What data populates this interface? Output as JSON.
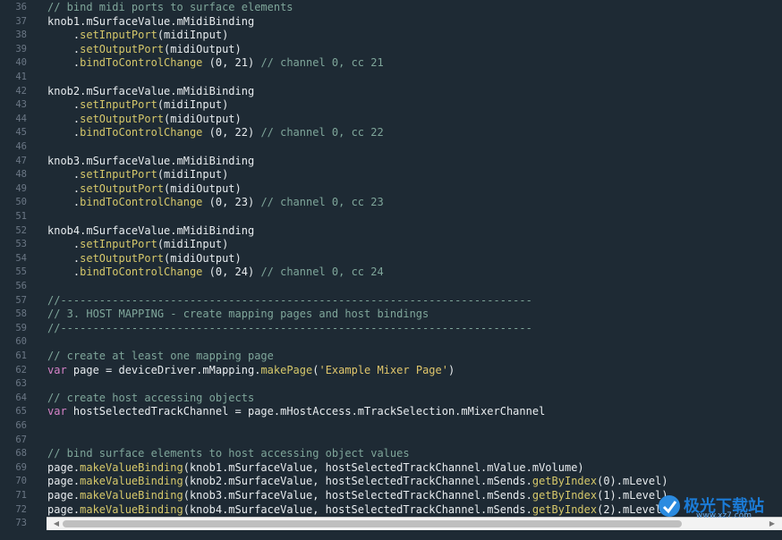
{
  "lines": [
    {
      "num": "36",
      "tokens": [
        {
          "t": "// bind midi ports to surface elements",
          "c": "comment"
        }
      ]
    },
    {
      "num": "37",
      "tokens": [
        {
          "t": "knob1.mSurfaceValue.mMidiBinding",
          "c": "plain"
        }
      ]
    },
    {
      "num": "38",
      "tokens": [
        {
          "t": "    .",
          "c": "plain"
        },
        {
          "t": "setInputPort",
          "c": "method"
        },
        {
          "t": "(midiInput)",
          "c": "plain"
        }
      ]
    },
    {
      "num": "39",
      "tokens": [
        {
          "t": "    .",
          "c": "plain"
        },
        {
          "t": "setOutputPort",
          "c": "method"
        },
        {
          "t": "(midiOutput)",
          "c": "plain"
        }
      ]
    },
    {
      "num": "40",
      "tokens": [
        {
          "t": "    .",
          "c": "plain"
        },
        {
          "t": "bindToControlChange",
          "c": "method"
        },
        {
          "t": " (0, 21) ",
          "c": "plain"
        },
        {
          "t": "// channel 0, cc 21",
          "c": "comment"
        }
      ]
    },
    {
      "num": "41",
      "tokens": []
    },
    {
      "num": "42",
      "tokens": [
        {
          "t": "knob2.mSurfaceValue.mMidiBinding",
          "c": "plain"
        }
      ]
    },
    {
      "num": "43",
      "tokens": [
        {
          "t": "    .",
          "c": "plain"
        },
        {
          "t": "setInputPort",
          "c": "method"
        },
        {
          "t": "(midiInput)",
          "c": "plain"
        }
      ]
    },
    {
      "num": "44",
      "tokens": [
        {
          "t": "    .",
          "c": "plain"
        },
        {
          "t": "setOutputPort",
          "c": "method"
        },
        {
          "t": "(midiOutput)",
          "c": "plain"
        }
      ]
    },
    {
      "num": "45",
      "tokens": [
        {
          "t": "    .",
          "c": "plain"
        },
        {
          "t": "bindToControlChange",
          "c": "method"
        },
        {
          "t": " (0, 22) ",
          "c": "plain"
        },
        {
          "t": "// channel 0, cc 22",
          "c": "comment"
        }
      ]
    },
    {
      "num": "46",
      "tokens": []
    },
    {
      "num": "47",
      "tokens": [
        {
          "t": "knob3.mSurfaceValue.mMidiBinding",
          "c": "plain"
        }
      ]
    },
    {
      "num": "48",
      "tokens": [
        {
          "t": "    .",
          "c": "plain"
        },
        {
          "t": "setInputPort",
          "c": "method"
        },
        {
          "t": "(midiInput)",
          "c": "plain"
        }
      ]
    },
    {
      "num": "49",
      "tokens": [
        {
          "t": "    .",
          "c": "plain"
        },
        {
          "t": "setOutputPort",
          "c": "method"
        },
        {
          "t": "(midiOutput)",
          "c": "plain"
        }
      ]
    },
    {
      "num": "50",
      "tokens": [
        {
          "t": "    .",
          "c": "plain"
        },
        {
          "t": "bindToControlChange",
          "c": "method"
        },
        {
          "t": " (0, 23) ",
          "c": "plain"
        },
        {
          "t": "// channel 0, cc 23",
          "c": "comment"
        }
      ]
    },
    {
      "num": "51",
      "tokens": []
    },
    {
      "num": "52",
      "tokens": [
        {
          "t": "knob4.mSurfaceValue.mMidiBinding",
          "c": "plain"
        }
      ]
    },
    {
      "num": "53",
      "tokens": [
        {
          "t": "    .",
          "c": "plain"
        },
        {
          "t": "setInputPort",
          "c": "method"
        },
        {
          "t": "(midiInput)",
          "c": "plain"
        }
      ]
    },
    {
      "num": "54",
      "tokens": [
        {
          "t": "    .",
          "c": "plain"
        },
        {
          "t": "setOutputPort",
          "c": "method"
        },
        {
          "t": "(midiOutput)",
          "c": "plain"
        }
      ]
    },
    {
      "num": "55",
      "tokens": [
        {
          "t": "    .",
          "c": "plain"
        },
        {
          "t": "bindToControlChange",
          "c": "method"
        },
        {
          "t": " (0, 24) ",
          "c": "plain"
        },
        {
          "t": "// channel 0, cc 24",
          "c": "comment"
        }
      ]
    },
    {
      "num": "56",
      "tokens": []
    },
    {
      "num": "57",
      "tokens": [
        {
          "t": "//-------------------------------------------------------------------------",
          "c": "comment"
        }
      ]
    },
    {
      "num": "58",
      "tokens": [
        {
          "t": "// 3. HOST MAPPING - create mapping pages and host bindings",
          "c": "comment"
        }
      ]
    },
    {
      "num": "59",
      "tokens": [
        {
          "t": "//-------------------------------------------------------------------------",
          "c": "comment"
        }
      ]
    },
    {
      "num": "60",
      "tokens": []
    },
    {
      "num": "61",
      "tokens": [
        {
          "t": "// create at least one mapping page",
          "c": "comment"
        }
      ]
    },
    {
      "num": "62",
      "tokens": [
        {
          "t": "var",
          "c": "keyword"
        },
        {
          "t": " page = deviceDriver.mMapping.",
          "c": "plain"
        },
        {
          "t": "makePage",
          "c": "method"
        },
        {
          "t": "(",
          "c": "plain"
        },
        {
          "t": "'Example Mixer Page'",
          "c": "string"
        },
        {
          "t": ")",
          "c": "plain"
        }
      ]
    },
    {
      "num": "63",
      "tokens": []
    },
    {
      "num": "64",
      "tokens": [
        {
          "t": "// create host accessing objects",
          "c": "comment"
        }
      ]
    },
    {
      "num": "65",
      "tokens": [
        {
          "t": "var",
          "c": "keyword"
        },
        {
          "t": " hostSelectedTrackChannel = page.mHostAccess.mTrackSelection.mMixerChannel",
          "c": "plain"
        }
      ]
    },
    {
      "num": "66",
      "tokens": []
    },
    {
      "num": "67",
      "tokens": []
    },
    {
      "num": "68",
      "tokens": [
        {
          "t": "// bind surface elements to host accessing object values",
          "c": "comment"
        }
      ]
    },
    {
      "num": "69",
      "tokens": [
        {
          "t": "page.",
          "c": "plain"
        },
        {
          "t": "makeValueBinding",
          "c": "method"
        },
        {
          "t": "(knob1.mSurfaceValue, hostSelectedTrackChannel.mValue.mVolume)",
          "c": "plain"
        }
      ]
    },
    {
      "num": "70",
      "tokens": [
        {
          "t": "page.",
          "c": "plain"
        },
        {
          "t": "makeValueBinding",
          "c": "method"
        },
        {
          "t": "(knob2.mSurfaceValue, hostSelectedTrackChannel.mSends.",
          "c": "plain"
        },
        {
          "t": "getByIndex",
          "c": "method"
        },
        {
          "t": "(0).mLevel)",
          "c": "plain"
        }
      ]
    },
    {
      "num": "71",
      "tokens": [
        {
          "t": "page.",
          "c": "plain"
        },
        {
          "t": "makeValueBinding",
          "c": "method"
        },
        {
          "t": "(knob3.mSurfaceValue, hostSelectedTrackChannel.mSends.",
          "c": "plain"
        },
        {
          "t": "getByIndex",
          "c": "method"
        },
        {
          "t": "(1).mLevel)",
          "c": "plain"
        }
      ]
    },
    {
      "num": "72",
      "tokens": [
        {
          "t": "page.",
          "c": "plain"
        },
        {
          "t": "makeValueBinding",
          "c": "method"
        },
        {
          "t": "(knob4.mSurfaceValue, hostSelectedTrackChannel.mSends.",
          "c": "plain"
        },
        {
          "t": "getByIndex",
          "c": "method"
        },
        {
          "t": "(2).mLevel)",
          "c": "plain"
        }
      ]
    },
    {
      "num": "73",
      "tokens": []
    }
  ],
  "scrollbar": {
    "left_arrow": "◀",
    "right_arrow": "▶",
    "position": 0.0
  },
  "watermark": {
    "text": "极光下载站",
    "url": "www.xz7.com"
  },
  "colors": {
    "background": "#1e2a34",
    "line_number": "#6b7785",
    "plain": "#e8ecef",
    "comment": "#7fa69a",
    "method": "#d6c86a",
    "keyword": "#d682c8",
    "string": "#e0c66b"
  }
}
